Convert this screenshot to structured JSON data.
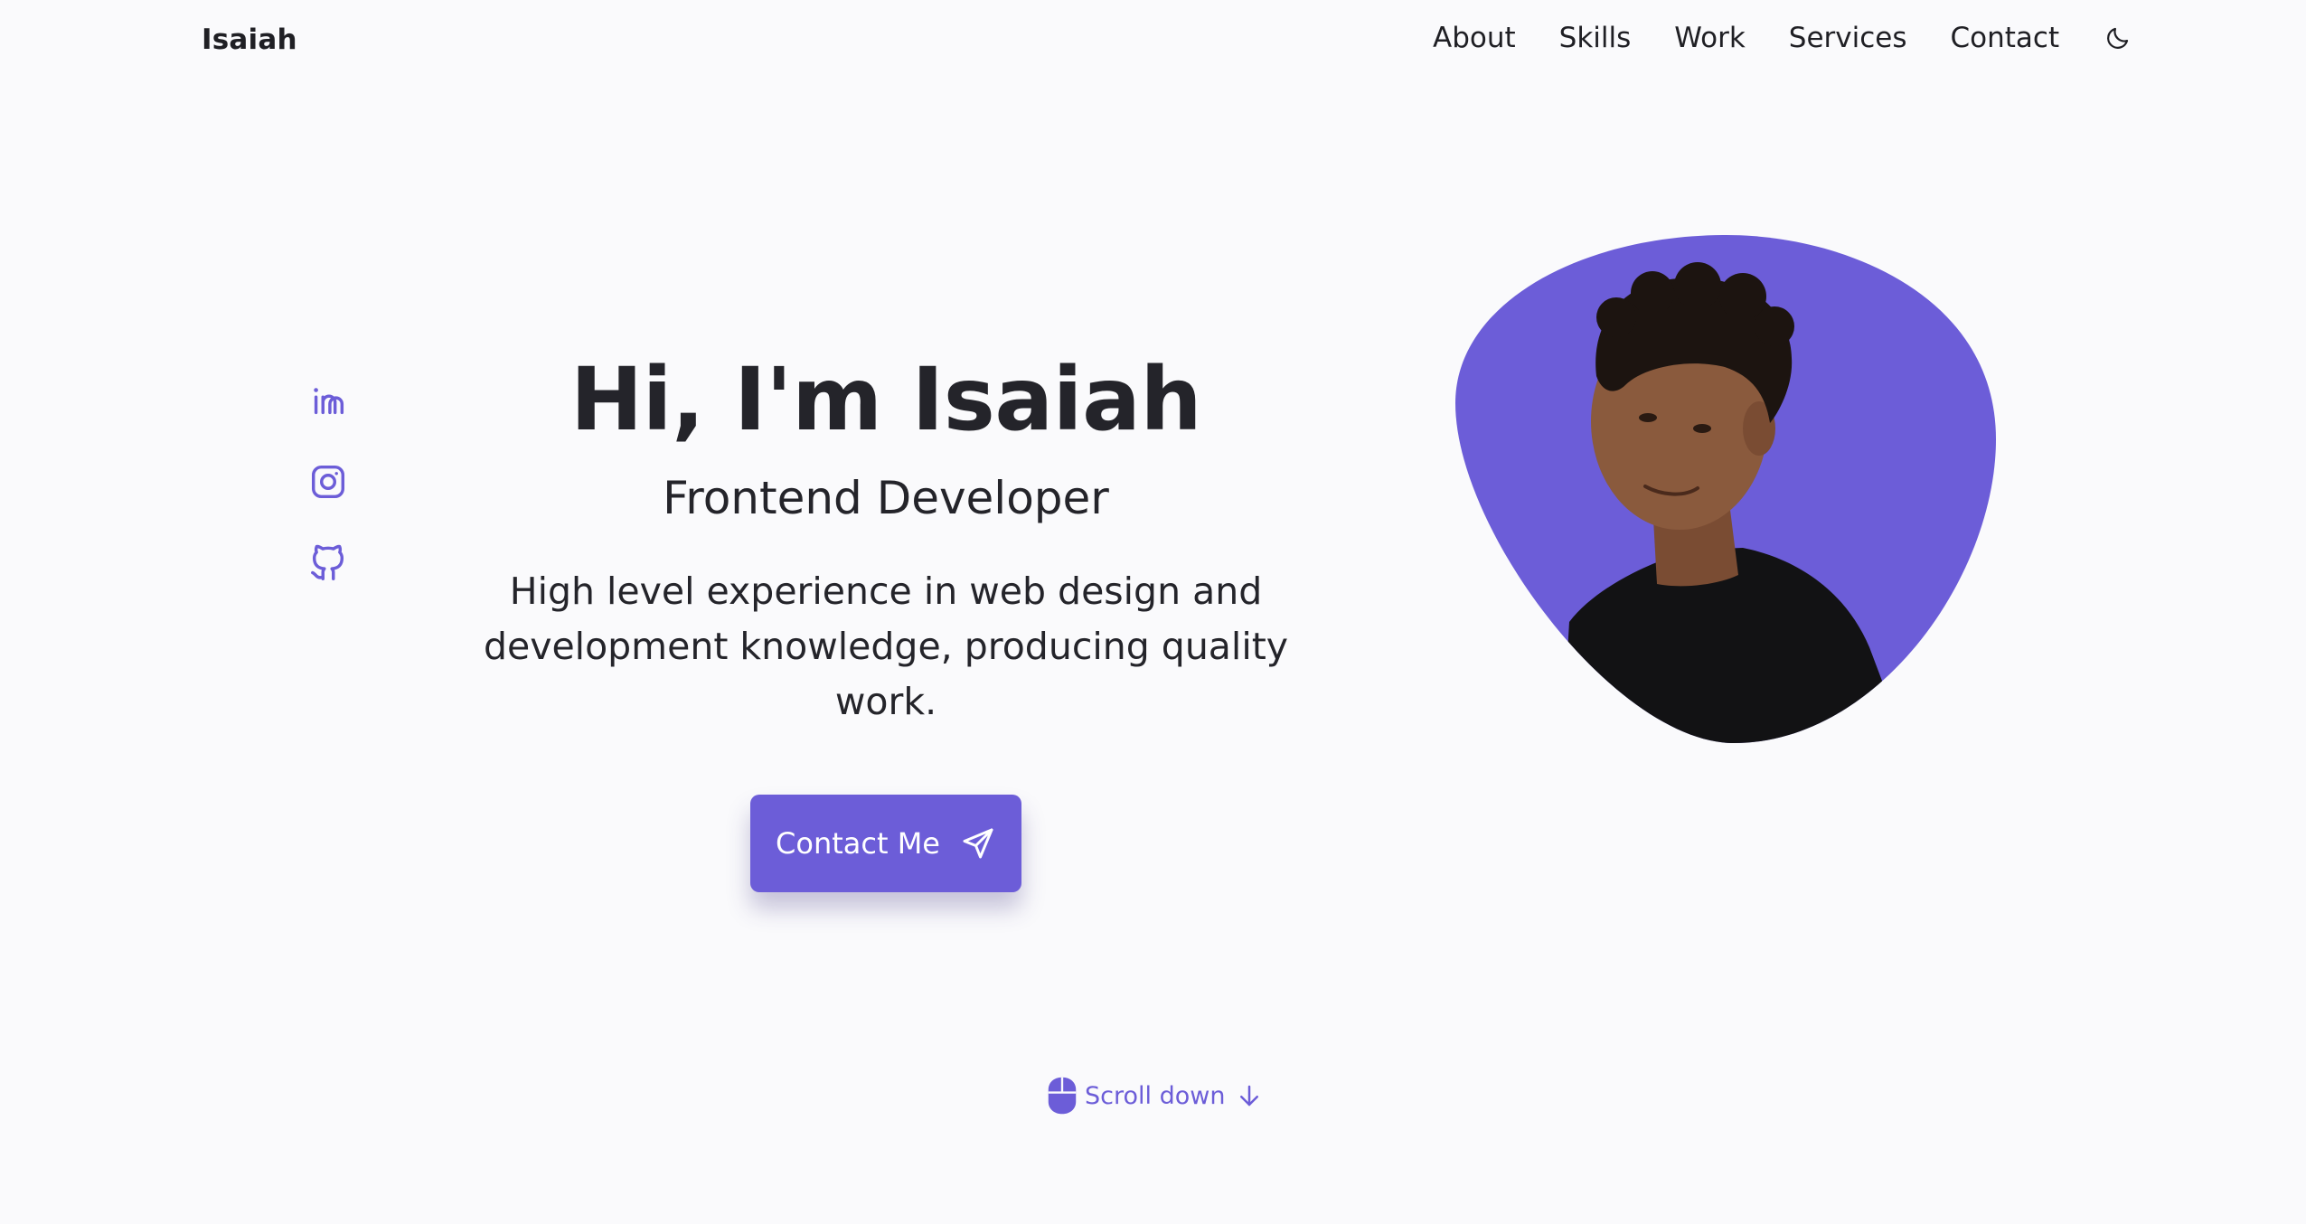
{
  "header": {
    "logo": "Isaiah",
    "nav": [
      "About",
      "Skills",
      "Work",
      "Services",
      "Contact"
    ],
    "theme_icon": "moon-icon"
  },
  "social": {
    "icons": [
      "linkedin-icon",
      "instagram-icon",
      "github-icon"
    ]
  },
  "hero": {
    "title": "Hi, I'm Isaiah",
    "subtitle": "Frontend Developer",
    "description": "High level experience in web design and development knowledge, producing quality work.",
    "button_label": "Contact Me",
    "button_icon": "send-icon"
  },
  "portrait": {
    "icon": "portrait-photo"
  },
  "scroll": {
    "label": "Scroll down",
    "icons": [
      "mouse-icon",
      "arrow-down-icon"
    ]
  },
  "colors": {
    "accent": "#6c5dd8",
    "background": "#fafafc",
    "text": "#24242a"
  }
}
